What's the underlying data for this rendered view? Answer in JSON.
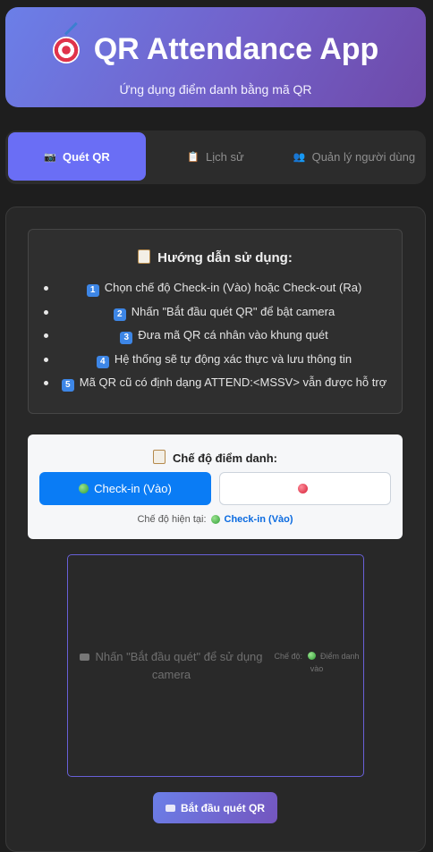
{
  "header": {
    "title": "QR Attendance App",
    "subtitle": "Ứng dụng điểm danh bằng mã QR",
    "icon": "target-icon"
  },
  "tabs": [
    {
      "label": "Quét QR",
      "icon": "camera-icon",
      "active": true
    },
    {
      "label": "Lịch sử",
      "icon": "clipboard-icon",
      "active": false
    },
    {
      "label": "Quản lý người dùng",
      "icon": "users-icon",
      "active": false
    }
  ],
  "guide": {
    "title": "Hướng dẫn sử dụng:",
    "items": [
      {
        "num": "1",
        "text": "Chọn chế độ Check-in (Vào) hoặc Check-out (Ra)"
      },
      {
        "num": "2",
        "text": "Nhấn \"Bắt đầu quét QR\" để bật camera"
      },
      {
        "num": "3",
        "text": "Đưa mã QR cá nhân vào khung quét"
      },
      {
        "num": "4",
        "text": "Hệ thống sẽ tự động xác thực và lưu thông tin"
      },
      {
        "num": "5",
        "text": "Mã QR cũ có định dạng ATTEND:<MSSV> vẫn được hỗ trợ"
      }
    ]
  },
  "mode": {
    "title": "Chế độ điểm danh:",
    "checkin_label": "Check-in (Vào)",
    "checkout_label": "",
    "current_prefix": "Chế độ hiện tại:",
    "current_value": "Check-in (Vào)"
  },
  "scanner": {
    "placeholder": "Nhấn \"Bắt đầu quét\" để sử dụng camera",
    "mode_prefix": "Chế độ:",
    "mode_value": "Điểm danh vào"
  },
  "start_button": "Bắt đầu quét QR",
  "colors": {
    "accent": "#6a6ef5",
    "checkin": "#0a7cf5",
    "background": "#1e1e1e"
  }
}
